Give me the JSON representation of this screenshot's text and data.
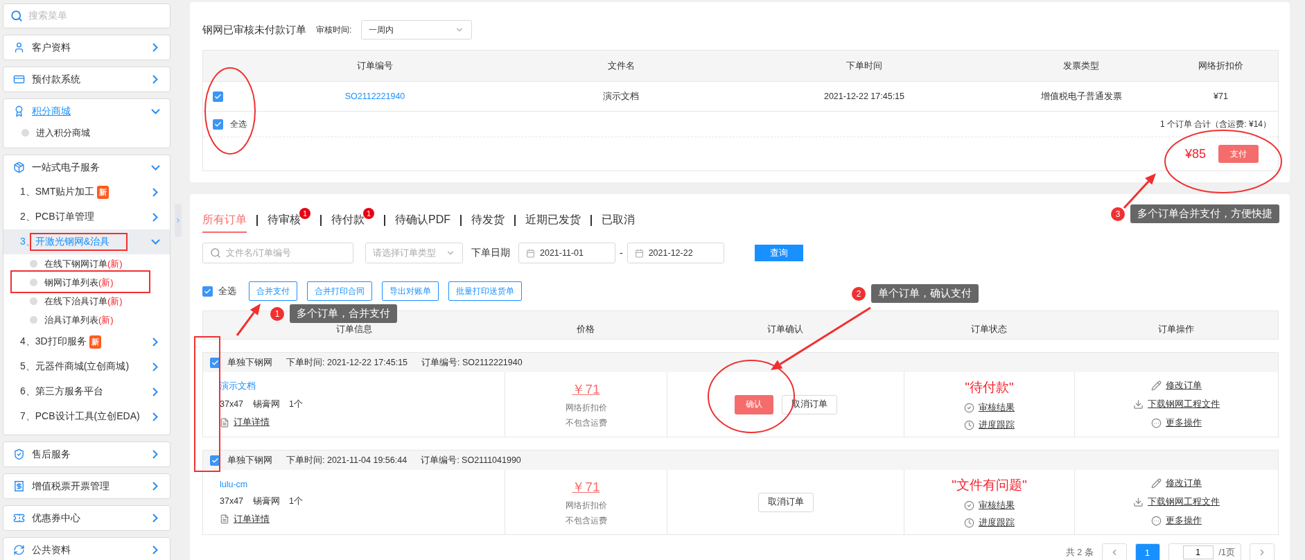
{
  "sidebar": {
    "search": {
      "placeholder": "搜索菜单"
    },
    "groups": [
      {
        "label": "客户资料",
        "selected": false,
        "expanded": false
      },
      {
        "label": "预付款系统",
        "selected": false,
        "expanded": false
      },
      {
        "label": "积分商城",
        "selected": true,
        "expanded": true,
        "items": [
          {
            "kind": "link",
            "label": "进入积分商城"
          }
        ]
      },
      {
        "label": "一站式电子服务",
        "selected": false,
        "expanded": true,
        "items": [
          {
            "kind": "menu",
            "label": "1、SMT贴片加工",
            "badge": "新",
            "selected": false,
            "expanded": false
          },
          {
            "kind": "menu",
            "label": "2、PCB订单管理",
            "selected": false,
            "expanded": false
          },
          {
            "kind": "menu",
            "label": "3、开激光钢网&治具",
            "selected": true,
            "expanded": true,
            "children": [
              {
                "label": "在线下钢网订单",
                "suffix": "(新)"
              },
              {
                "label": "钢网订单列表",
                "suffix": "(新)"
              },
              {
                "label": "在线下治具订单",
                "suffix": "(新)"
              },
              {
                "label": "治具订单列表",
                "suffix": "(新)"
              }
            ]
          },
          {
            "kind": "menu",
            "label": "4、3D打印服务",
            "badge": "新",
            "selected": false,
            "expanded": false
          },
          {
            "kind": "menu",
            "label": "5、元器件商城(立创商城)",
            "selected": false,
            "expanded": false
          },
          {
            "kind": "menu",
            "label": "6、第三方服务平台",
            "selected": false,
            "expanded": false
          },
          {
            "kind": "menu",
            "label": "7、PCB设计工具(立创EDA)",
            "selected": false,
            "expanded": false
          }
        ]
      },
      {
        "label": "售后服务",
        "selected": false,
        "expanded": false
      },
      {
        "label": "增值税票开票管理",
        "selected": false,
        "expanded": false
      },
      {
        "label": "优惠券中心",
        "selected": false,
        "expanded": false
      },
      {
        "label": "公共资料",
        "selected": false,
        "expanded": false
      }
    ]
  },
  "unpaid_panel": {
    "title": "钢网已审核未付款订单",
    "filter_label": "审核时间:",
    "filter_value": "一周内",
    "columns": [
      "订单编号",
      "文件名",
      "下单时间",
      "发票类型",
      "网络折扣价"
    ],
    "rows": [
      {
        "checked": true,
        "cells": [
          "SO2112221940",
          "演示文档",
          "2021-12-22 17:45:15",
          "增值税电子普通发票",
          "¥71"
        ]
      }
    ],
    "select_all": {
      "label": "全选",
      "checked": true
    },
    "summary": "1 个订单 合计（含运费: ¥14）",
    "total": "¥85",
    "pay_button": "支付"
  },
  "orders_panel": {
    "tabs": [
      {
        "label": "所有订单",
        "selected": true
      },
      {
        "label": "待审核",
        "selected": false,
        "badge": "1"
      },
      {
        "label": "待付款",
        "selected": false,
        "badge": "1"
      },
      {
        "label": "待确认PDF",
        "selected": false
      },
      {
        "label": "待发货",
        "selected": false
      },
      {
        "label": "近期已发货",
        "selected": false
      },
      {
        "label": "已取消",
        "selected": false
      }
    ],
    "search": {
      "placeholder": "文件名/订单编号"
    },
    "type_select": {
      "placeholder": "请选择订单类型"
    },
    "date_label": "下单日期",
    "date_from": "2021-11-01",
    "date_separator": "-",
    "date_to": "2021-12-22",
    "query_button": "查询",
    "select_all": {
      "label": "全选",
      "checked": true
    },
    "actions": [
      "合并支付",
      "合并打印合同",
      "导出对账单",
      "批量打印送货单"
    ],
    "columns": [
      "订单信息",
      "价格",
      "订单确认",
      "订单状态",
      "订单操作"
    ],
    "orders": [
      {
        "checked": true,
        "type": "单独下钢网",
        "time_label": "下单时间:",
        "time": "2021-12-22 17:45:15",
        "number_label": "订单编号:",
        "number": "SO2112221940",
        "file": "演示文档",
        "size": "37x47",
        "material": "锡膏网",
        "quantity": "1个",
        "detail_link": "订单详情",
        "price": "￥71",
        "price_notes": [
          "网络折扣价",
          "不包含运费"
        ],
        "confirm_button": "确认",
        "cancel_button": "取消订单",
        "status": "\"待付款\"",
        "status_links": [
          {
            "kind": "check",
            "label": "审核结果"
          },
          {
            "kind": "clock",
            "label": "进度跟踪"
          }
        ],
        "operations": [
          {
            "kind": "edit",
            "label": "修改订单"
          },
          {
            "kind": "download",
            "label": "下载钢网工程文件"
          },
          {
            "kind": "more",
            "label": "更多操作"
          }
        ]
      },
      {
        "checked": true,
        "type": "单独下钢网",
        "time_label": "下单时间:",
        "time": "2021-11-04 19:56:44",
        "number_label": "订单编号:",
        "number": "SO2111041990",
        "file": "lulu-cm",
        "size": "37x47",
        "material": "锡膏网",
        "quantity": "1个",
        "detail_link": "订单详情",
        "price": "￥71",
        "price_notes": [
          "网络折扣价",
          "不包含运费"
        ],
        "cancel_button": "取消订单",
        "status": "\"文件有问题\"",
        "status_links": [
          {
            "kind": "check",
            "label": "审核结果"
          },
          {
            "kind": "clock",
            "label": "进度跟踪"
          }
        ],
        "operations": [
          {
            "kind": "edit",
            "label": "修改订单"
          },
          {
            "kind": "download",
            "label": "下载钢网工程文件"
          },
          {
            "kind": "more",
            "label": "更多操作"
          }
        ]
      }
    ],
    "pagination": {
      "total": "共 2 条",
      "current": "1",
      "page_input": "1",
      "page_count": "/1页"
    }
  },
  "annotations": [
    {
      "number": "1",
      "text": "多个订单，合并支付"
    },
    {
      "number": "2",
      "text": "单个订单，确认支付"
    },
    {
      "number": "3",
      "text": "多个订单合并支付，方便快捷"
    }
  ]
}
